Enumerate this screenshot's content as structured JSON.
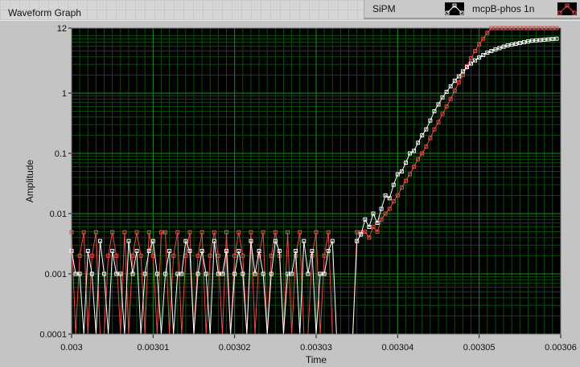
{
  "graph_title": "Waveform Graph",
  "legend": [
    {
      "label": "SiPM",
      "color": "#ffffff"
    },
    {
      "label": "mcpB-phos 1n",
      "color": "#e84c4c"
    }
  ],
  "chart_data": {
    "type": "line",
    "title": "Waveform Graph",
    "xlabel": "Time",
    "ylabel": "Amplitude",
    "xlim": [
      0.003,
      0.00306
    ],
    "ylim": [
      0.0001,
      12
    ],
    "yscale": "log",
    "grid": true,
    "legend_position": "top-right",
    "x_ticks": [
      "0.003",
      "0.00301",
      "0.00302",
      "0.00303",
      "0.00304",
      "0.00305",
      "0.00306"
    ],
    "x_tick_values": [
      0.003,
      0.00301,
      0.00302,
      0.00303,
      0.00304,
      0.00305,
      0.00306
    ],
    "y_ticks": [
      "12",
      "1",
      "0.1",
      "0.01",
      "0.001",
      "0.0001"
    ],
    "y_tick_values": [
      12,
      1,
      0.1,
      0.01,
      0.001,
      0.0001
    ],
    "t0": 0.003,
    "dt": 5e-07,
    "series": [
      {
        "name": "SiPM",
        "color": "#ffffff",
        "values": [
          0.0024,
          0.001,
          0.001,
          0,
          0.0024,
          0.001,
          0,
          0.0035,
          0.001,
          0,
          0.0024,
          0.001,
          0.001,
          0,
          0.0035,
          0.001,
          0.0024,
          0,
          0.001,
          0.0024,
          0.0035,
          0.001,
          0,
          0.001,
          0.0024,
          0,
          0.001,
          0.001,
          0.0035,
          0.0024,
          0,
          0.001,
          0.0024,
          0.001,
          0,
          0.0035,
          0.001,
          0.001,
          0.0024,
          0,
          0.001,
          0.0024,
          0.001,
          0,
          0.0035,
          0.001,
          0.0024,
          0.001,
          0,
          0.001,
          0.0035,
          0.0024,
          0,
          0.001,
          0.001,
          0.0024,
          0,
          0.0035,
          0.001,
          0.0024,
          0,
          0.001,
          0.001,
          0.0024,
          0.0035,
          0,
          0,
          0,
          0,
          0,
          0.0035,
          0.0045,
          0.008,
          0.006,
          0.01,
          0.007,
          0.012,
          0.02,
          0.018,
          0.03,
          0.045,
          0.05,
          0.07,
          0.1,
          0.11,
          0.15,
          0.2,
          0.25,
          0.35,
          0.5,
          0.65,
          0.85,
          1.05,
          1.3,
          1.6,
          1.9,
          2.3,
          2.7,
          3.1,
          3.5,
          3.9,
          4.3,
          4.7,
          5.0,
          5.3,
          5.6,
          5.9,
          6.2,
          6.4,
          6.6,
          6.8,
          7.0,
          7.2,
          7.4,
          7.5,
          7.6,
          7.7,
          7.8,
          7.9,
          8.0,
          8.0
        ]
      },
      {
        "name": "mcpB-phos 1n",
        "color": "#e84c4c",
        "values": [
          0.0049,
          0,
          0.002,
          0.0049,
          0,
          0.002,
          0.0049,
          0,
          0,
          0.002,
          0.0049,
          0.002,
          0,
          0.0049,
          0,
          0.002,
          0.0049,
          0.002,
          0,
          0.0049,
          0.002,
          0,
          0.0049,
          0.0049,
          0,
          0.002,
          0.0049,
          0,
          0.002,
          0.0049,
          0,
          0.002,
          0.0049,
          0,
          0.002,
          0.0049,
          0.002,
          0,
          0.0049,
          0,
          0.002,
          0.0049,
          0.002,
          0,
          0.0049,
          0,
          0.002,
          0.0049,
          0,
          0.002,
          0.0049,
          0.002,
          0,
          0.0049,
          0,
          0.002,
          0.0049,
          0,
          0,
          0.002,
          0.0049,
          0,
          0.002,
          0.0049,
          0,
          0,
          0,
          0,
          0,
          0,
          0.0049,
          0.0049,
          0.005,
          0.004,
          0.006,
          0.005,
          0.008,
          0.01,
          0.012,
          0.016,
          0.02,
          0.027,
          0.035,
          0.045,
          0.06,
          0.08,
          0.1,
          0.13,
          0.18,
          0.25,
          0.33,
          0.45,
          0.6,
          0.8,
          1.1,
          1.5,
          2,
          2.8,
          3.8,
          5,
          6.5,
          8,
          10,
          12,
          12,
          12,
          12,
          12,
          12,
          12,
          12,
          12,
          12,
          12,
          12,
          12,
          12,
          12,
          12,
          12,
          12
        ]
      }
    ]
  }
}
